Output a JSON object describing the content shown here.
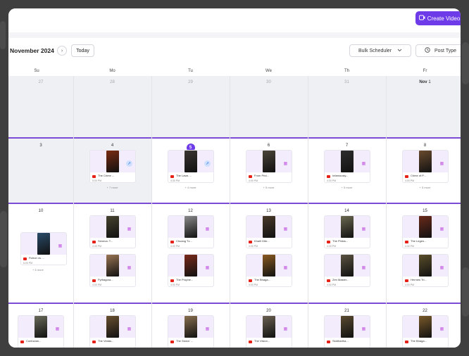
{
  "header": {
    "create_label": "Create Video",
    "create_icon": "video-plus-icon"
  },
  "toolbar": {
    "month": "November 2024",
    "today_label": "Today",
    "bulk_label": "Bulk Scheduler",
    "post_label": "Post Type"
  },
  "weekdays": [
    "Su",
    "Mo",
    "Tu",
    "We",
    "Th",
    "Fr"
  ],
  "colors": {
    "accent": "#6d3be8",
    "youtube": "#e62117",
    "card_bg": "#f2ecfd"
  },
  "weeks": [
    {
      "days": [
        {
          "num": "27",
          "muted": true,
          "past": true,
          "cards": []
        },
        {
          "num": "28",
          "muted": true,
          "past": true,
          "cards": []
        },
        {
          "num": "29",
          "muted": true,
          "past": true,
          "cards": []
        },
        {
          "num": "30",
          "muted": true,
          "past": true,
          "cards": []
        },
        {
          "num": "31",
          "muted": true,
          "past": true,
          "cards": []
        },
        {
          "num": "Nov 1",
          "past": true,
          "cards": []
        }
      ]
    },
    {
      "days": [
        {
          "num": "3",
          "past": true,
          "cards": []
        },
        {
          "num": "4",
          "past": true,
          "cards": [
            {
              "title": "The Crime ...",
              "time": "5:00 PM",
              "badge": "rocket",
              "thumb": "#7a2b12"
            }
          ],
          "more": "+ 7 more"
        },
        {
          "num": "5",
          "today": true,
          "cards": [
            {
              "title": "The Laws ...",
              "time": "4:30 PM",
              "badge": "rocket",
              "thumb": "#3a3632"
            }
          ],
          "more": "+ 4 more"
        },
        {
          "num": "6",
          "cards": [
            {
              "title": "From Prid...",
              "time": "4:00 PM",
              "badge": "calendar",
              "thumb": "#4b4438"
            }
          ],
          "more": "+ 5 more"
        },
        {
          "num": "7",
          "cards": [
            {
              "title": "Infamously...",
              "time": "4:30 PM",
              "badge": "calendar",
              "thumb": "#2d2d2d"
            }
          ],
          "more": "+ 5 more"
        },
        {
          "num": "8",
          "cards": [
            {
              "title": "Crime of P...",
              "time": "4:00 PM",
              "badge": "calendar",
              "thumb": "#6a4a2f"
            }
          ],
          "more": "+ 5 more"
        }
      ]
    },
    {
      "days": [
        {
          "num": "10",
          "cards": [
            {
              "title": "Fiction vs. ...",
              "time": "6:00 PM",
              "badge": "calendar",
              "thumb": "#2a4c6a"
            }
          ],
          "more": "+ 6 more"
        },
        {
          "num": "11",
          "cards": [
            {
              "title": "Seneca: T...",
              "time": "4:30 PM",
              "badge": "calendar",
              "thumb": "#47432f"
            },
            {
              "title": "Pythagora...",
              "time": "4:00 PM",
              "badge": "calendar",
              "thumb": "#9a7553"
            }
          ]
        },
        {
          "num": "12",
          "cards": [
            {
              "title": "Chuang Tz...",
              "time": "4:30 PM",
              "badge": "calendar",
              "thumb": "#8a8a8a"
            },
            {
              "title": "The Prophe...",
              "time": "4:00 PM",
              "badge": "calendar",
              "thumb": "#7a2a1a"
            }
          ]
        },
        {
          "num": "13",
          "cards": [
            {
              "title": "Khalil Gibr...",
              "time": "4:30 PM",
              "badge": "calendar",
              "thumb": "#4a3a28"
            },
            {
              "title": "The Bhaga...",
              "time": "4:00 PM",
              "badge": "calendar",
              "thumb": "#8a5a20"
            }
          ]
        },
        {
          "num": "14",
          "cards": [
            {
              "title": "The Philos...",
              "time": "4:30 PM",
              "badge": "calendar",
              "thumb": "#6b6850"
            },
            {
              "title": "Zen Master...",
              "time": "4:00 PM",
              "badge": "calendar",
              "thumb": "#5b5240"
            }
          ]
        },
        {
          "num": "15",
          "cards": [
            {
              "title": "The Legen...",
              "time": "4:30 PM",
              "badge": "calendar",
              "thumb": "#6a2a1a"
            },
            {
              "title": "Hermes Tri...",
              "time": "4:00 PM",
              "badge": "calendar",
              "thumb": "#5a4e2a"
            }
          ]
        }
      ]
    },
    {
      "days": [
        {
          "num": "17",
          "cards": [
            {
              "title": "Confucian...",
              "time": "",
              "badge": "calendar",
              "thumb": "#6a6a5a"
            }
          ]
        },
        {
          "num": "18",
          "cards": [
            {
              "title": "The Vedas...",
              "time": "",
              "badge": "calendar",
              "thumb": "#6a5030"
            }
          ]
        },
        {
          "num": "19",
          "cards": [
            {
              "title": "The Stoics' ...",
              "time": "",
              "badge": "calendar",
              "thumb": "#8a7050"
            }
          ]
        },
        {
          "num": "20",
          "cards": [
            {
              "title": "The Vision...",
              "time": "",
              "badge": "calendar",
              "thumb": "#6a6050"
            }
          ]
        },
        {
          "num": "21",
          "cards": [
            {
              "title": "Siddhartha...",
              "time": "",
              "badge": "calendar",
              "thumb": "#5a4a30"
            }
          ]
        },
        {
          "num": "22",
          "cards": [
            {
              "title": "The Bhaga...",
              "time": "",
              "badge": "calendar",
              "thumb": "#7a5a2a"
            }
          ]
        }
      ]
    }
  ]
}
